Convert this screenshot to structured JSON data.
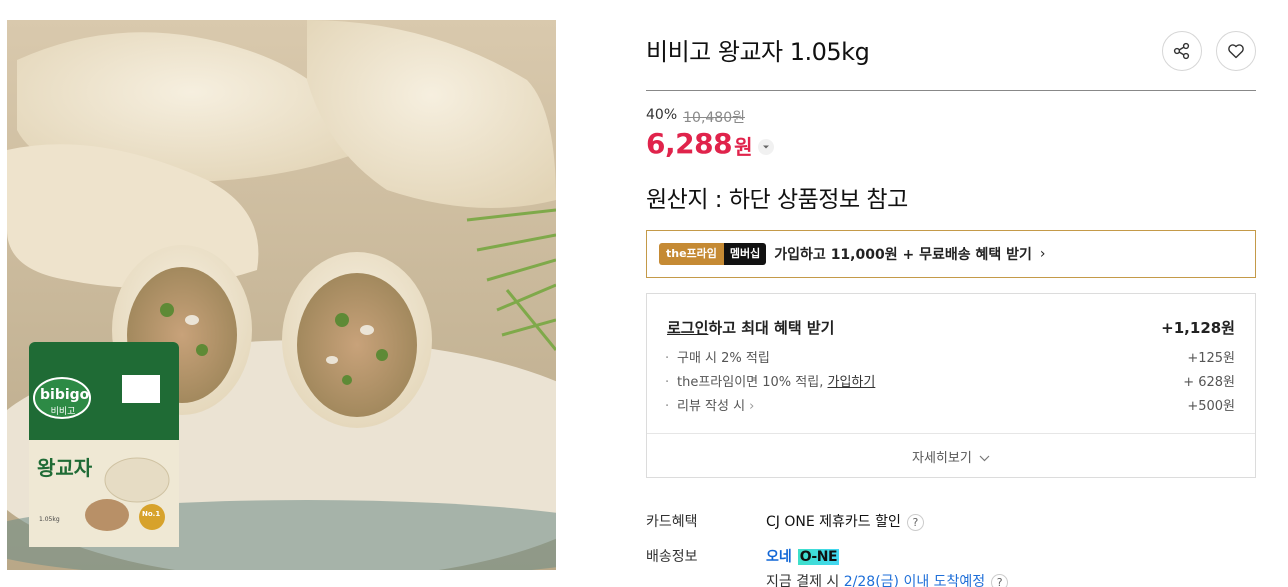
{
  "product": {
    "title": "비비고 왕교자 1.05kg",
    "image_alt": "비비고 왕교자",
    "package_brand": "bibigo",
    "package_brand_kr": "비비고",
    "package_name": "왕교자",
    "package_badge": "No.1",
    "package_weight": "1.05kg"
  },
  "price": {
    "discount_rate": "40%",
    "original_price": "10,480원",
    "sale_price": "6,288",
    "currency": "원"
  },
  "origin": "원산지 : 하단 상품정보 참고",
  "prime": {
    "badge_the": "the프라임",
    "badge_member": "멤버십",
    "text": "가입하고 11,000원 + 무료배송 혜택 받기",
    "arrow": "›"
  },
  "benefits": {
    "login_link": "로그인",
    "head_rest": "하고 최대 혜택 받기",
    "total": "+1,128원",
    "items": [
      {
        "label": "구매 시 2% 적립",
        "amount": "+125원"
      },
      {
        "label": "the프라임이면 10% 적립, ",
        "link": "가입하기",
        "amount": "+ 628원"
      },
      {
        "label": "리뷰 작성 시",
        "amount": "+500원"
      }
    ],
    "more": "자세히보기"
  },
  "card_benefit": {
    "label": "카드혜택",
    "value": "CJ ONE 제휴카드 할인"
  },
  "delivery": {
    "label": "배송정보",
    "service": "오네",
    "logo_text": "O-NE",
    "pay_prefix": "지금 결제 시",
    "date_text": "2/28(금) 이내 도착예정"
  },
  "colors": {
    "accent": "#e0234b",
    "prime_border": "#c49a49",
    "link_blue": "#1f6fd8"
  },
  "icons": [
    "share-icon",
    "heart-icon",
    "chevron-down-icon",
    "chevron-right-icon",
    "question-icon"
  ]
}
